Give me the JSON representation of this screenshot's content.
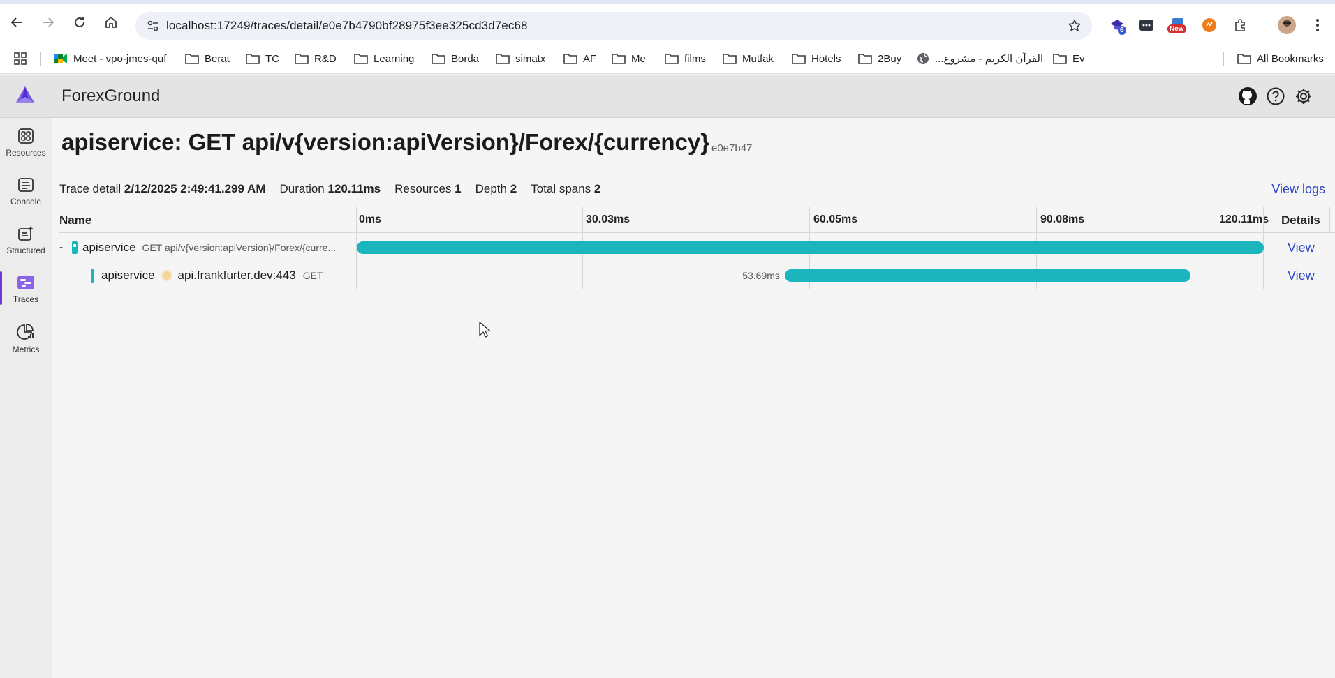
{
  "browser": {
    "url": "localhost:17249/traces/detail/e0e7b4790bf28975f3ee325cd3d7ec68",
    "extensions": {
      "badge_count": "6",
      "new_badge": "New"
    },
    "bookmarks": [
      {
        "label": "Meet - vpo-jmes-quf",
        "icon": "meet-icon"
      },
      {
        "label": "Berat",
        "icon": "folder-icon"
      },
      {
        "label": "TC",
        "icon": "folder-icon"
      },
      {
        "label": "R&D",
        "icon": "folder-icon"
      },
      {
        "label": "Learning",
        "icon": "folder-icon"
      },
      {
        "label": "Borda",
        "icon": "folder-icon"
      },
      {
        "label": "simatx",
        "icon": "folder-icon"
      },
      {
        "label": "AF",
        "icon": "folder-icon"
      },
      {
        "label": "Me",
        "icon": "folder-icon"
      },
      {
        "label": "films",
        "icon": "folder-icon"
      },
      {
        "label": "Mutfak",
        "icon": "folder-icon"
      },
      {
        "label": "Hotels",
        "icon": "folder-icon"
      },
      {
        "label": "2Buy",
        "icon": "folder-icon"
      },
      {
        "label": "القرآن الكريم - مشروع...",
        "icon": "globe-icon"
      },
      {
        "label": "Ev",
        "icon": "folder-icon"
      }
    ],
    "all_bookmarks": "All Bookmarks"
  },
  "app": {
    "title": "ForexGround",
    "accent_color": "#6c3bd9",
    "span_color": "#1ab5bd"
  },
  "sidebar": {
    "items": [
      {
        "label": "Resources",
        "icon": "resources-icon"
      },
      {
        "label": "Console",
        "icon": "console-icon"
      },
      {
        "label": "Structured",
        "icon": "structured-icon"
      },
      {
        "label": "Traces",
        "icon": "traces-icon",
        "active": true
      },
      {
        "label": "Metrics",
        "icon": "metrics-icon"
      }
    ]
  },
  "trace": {
    "title": "apiservice: GET api/v{version:apiVersion}/Forex/{currency}",
    "short_id": "e0e7b47",
    "summary": {
      "detail_label": "Trace detail",
      "detail_value": "2/12/2025 2:49:41.299 AM",
      "duration_label": "Duration",
      "duration_value": "120.11ms",
      "resources_label": "Resources",
      "resources_value": "1",
      "depth_label": "Depth",
      "depth_value": "2",
      "spans_label": "Total spans",
      "spans_value": "2"
    },
    "view_logs": "View logs",
    "columns": {
      "name": "Name",
      "details": "Details",
      "ticks": [
        "0ms",
        "30.03ms",
        "60.05ms",
        "90.08ms",
        "120.11ms"
      ]
    },
    "total_ms": 120.11,
    "spans": [
      {
        "collapse": "-",
        "service": "apiservice",
        "name": "GET api/v{version:apiVersion}/Forex/{curre...",
        "start_ms": 0,
        "duration_ms": 120.11,
        "view": "View"
      },
      {
        "service": "apiservice",
        "peer": "api.frankfurter.dev:443",
        "method": "GET",
        "start_ms": 56.7,
        "duration_ms": 53.69,
        "duration_label": "53.69ms",
        "view": "View"
      }
    ]
  }
}
